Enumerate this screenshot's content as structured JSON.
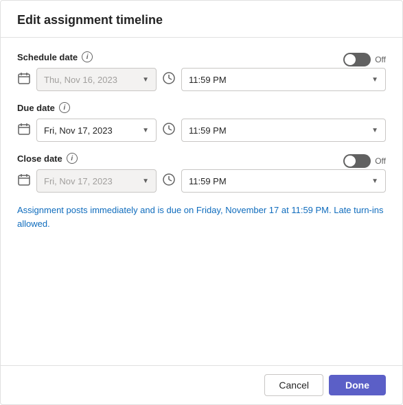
{
  "dialog": {
    "title": "Edit assignment timeline"
  },
  "schedule": {
    "label": "Schedule date",
    "toggle_state": "Off",
    "date_placeholder": "Thu, Nov 16, 2023",
    "time_value": "11:59 PM",
    "disabled": true
  },
  "due": {
    "label": "Due date",
    "date_value": "Fri, Nov 17, 2023",
    "time_value": "11:59 PM",
    "disabled": false
  },
  "close": {
    "label": "Close date",
    "toggle_state": "Off",
    "date_placeholder": "Fri, Nov 17, 2023",
    "time_value": "11:59 PM",
    "disabled": true
  },
  "info_text": "Assignment posts immediately and is due on Friday, November 17 at 11:59 PM. Late turn-ins allowed.",
  "footer": {
    "cancel_label": "Cancel",
    "done_label": "Done"
  }
}
